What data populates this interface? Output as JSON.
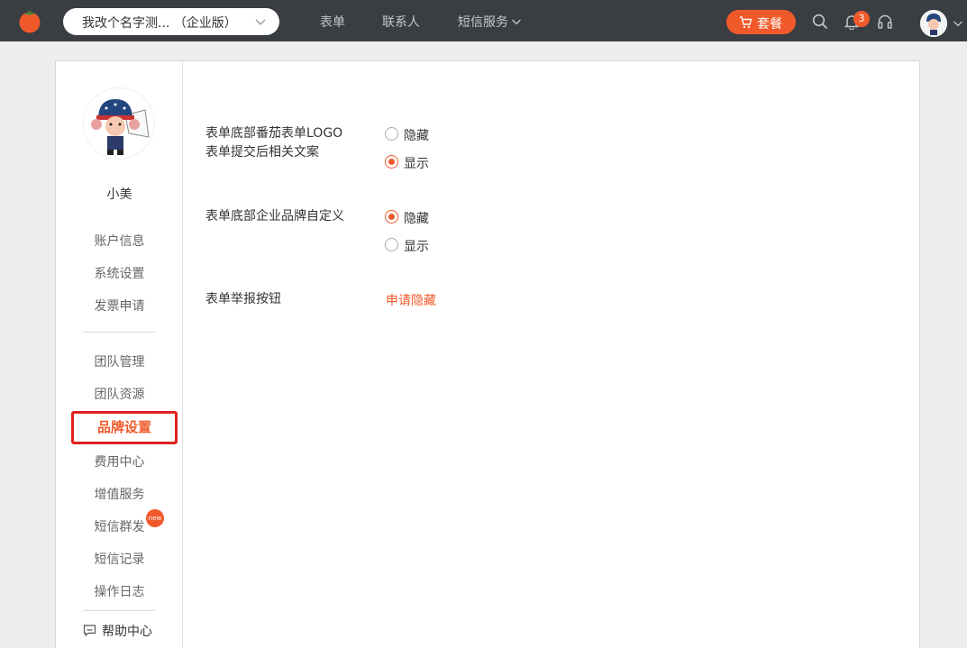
{
  "header": {
    "workspace_name": "我改个名字测...  （企业版）",
    "nav": [
      "表单",
      "联系人",
      "短信服务"
    ],
    "plan_label": "套餐",
    "notification_count": "3",
    "colors": {
      "bar": "#3a3d42",
      "accent": "#f05a2a"
    }
  },
  "sidebar": {
    "username": "小美",
    "group1": [
      "账户信息",
      "系统设置",
      "发票申请"
    ],
    "group2": [
      "团队管理",
      "团队资源"
    ],
    "active_item": "品牌设置",
    "group3": [
      "费用中心",
      "增值服务",
      "短信群发",
      "短信记录",
      "操作日志"
    ],
    "new_badge": "new",
    "help": "帮助中心"
  },
  "settings": {
    "logo_setting": {
      "label_line1": "表单底部番茄表单LOGO",
      "label_line2": "表单提交后相关文案",
      "options": [
        "隐藏",
        "显示"
      ],
      "selected": "显示"
    },
    "brand_setting": {
      "label": "表单底部企业品牌自定义",
      "options": [
        "隐藏",
        "显示"
      ],
      "selected": "隐藏"
    },
    "report_setting": {
      "label": "表单举报按钮",
      "action": "申请隐藏"
    }
  }
}
